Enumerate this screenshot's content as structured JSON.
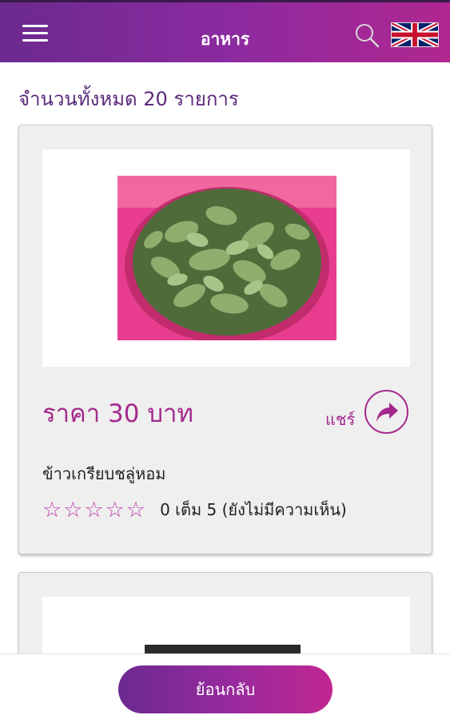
{
  "header": {
    "title": "อาหาร",
    "menu_icon": "hamburger-menu-icon",
    "search_icon": "search-icon",
    "language_flag": "uk-flag-icon"
  },
  "summary": {
    "count_text": "จำนวนทั้งหมด 20 รายการ"
  },
  "products": [
    {
      "price_text": "ราคา 30 บาท",
      "share_label": "แชร์",
      "share_icon": "share-arrow-icon",
      "name": "ข้าวเกรียบชลู่หอม",
      "rating": 0,
      "rating_max": 5,
      "rating_text": "0 เต็ม 5 (ยังไม่มีความเห็น)"
    }
  ],
  "footer": {
    "back_label": "ย้อนกลับ"
  },
  "colors": {
    "accent": "#a4288c",
    "header_start": "#6b2a8f",
    "header_end": "#b0278f"
  }
}
